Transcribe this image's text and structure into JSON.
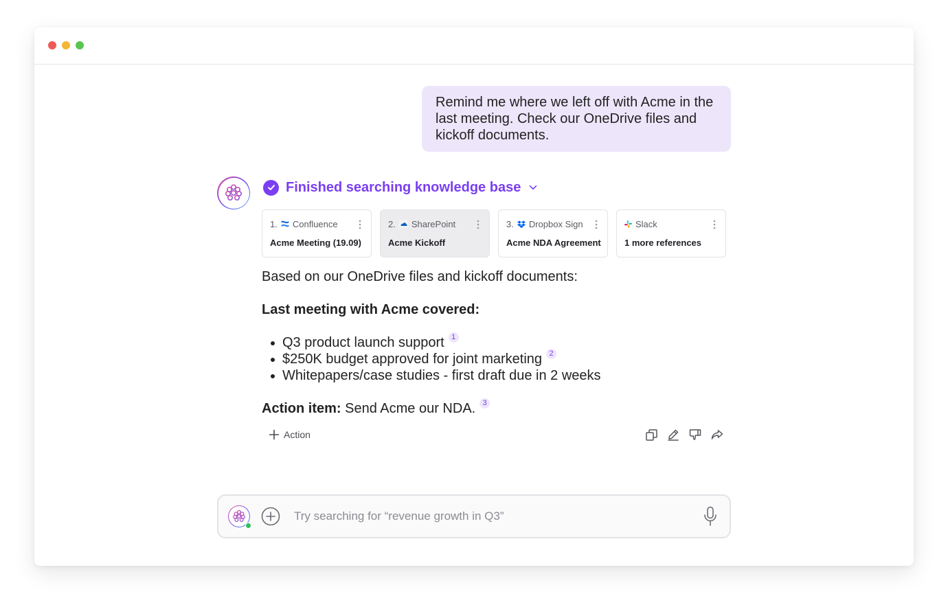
{
  "window": {
    "controls": [
      "close",
      "minimize",
      "maximize"
    ]
  },
  "user_message": "Remind me where we left off with Acme in the last meeting. Check our OneDrive files and kickoff documents.",
  "assistant": {
    "avatar_icon": "brain-icon",
    "status": "Finished searching knowledge base",
    "references": [
      {
        "index": "1.",
        "source": "Confluence",
        "icon": "confluence-icon",
        "title": "Acme Meeting (19.09)"
      },
      {
        "index": "2.",
        "source": "SharePoint",
        "icon": "sharepoint-icon",
        "title": "Acme Kickoff"
      },
      {
        "index": "3.",
        "source": "Dropbox Sign",
        "icon": "dropbox-icon",
        "title": "Acme NDA Agreement"
      },
      {
        "index": "",
        "source": "Slack",
        "icon": "slack-icon",
        "title": "1 more references"
      }
    ],
    "answer": {
      "intro": "Based on our OneDrive files and kickoff documents:",
      "heading": "Last meeting with Acme covered:",
      "bullets": [
        {
          "text": "Q3 product launch support",
          "cite": "1"
        },
        {
          "text": "$250K budget approved for joint marketing",
          "cite": "2"
        },
        {
          "text": "Whitepapers/case studies - first draft due in 2 weeks",
          "cite": ""
        }
      ],
      "action_label": "Action item:",
      "action_text": "Send Acme our NDA.",
      "action_cite": "3"
    },
    "add_action_label": "Action",
    "tools": [
      "copy-icon",
      "edit-icon",
      "thumbs-down-icon",
      "share-icon"
    ]
  },
  "composer": {
    "placeholder": "Try searching for “revenue growth in Q3”",
    "value": ""
  },
  "colors": {
    "accent": "#7a3ff2",
    "bubble": "#ede6fb",
    "online": "#2fbf5b"
  }
}
